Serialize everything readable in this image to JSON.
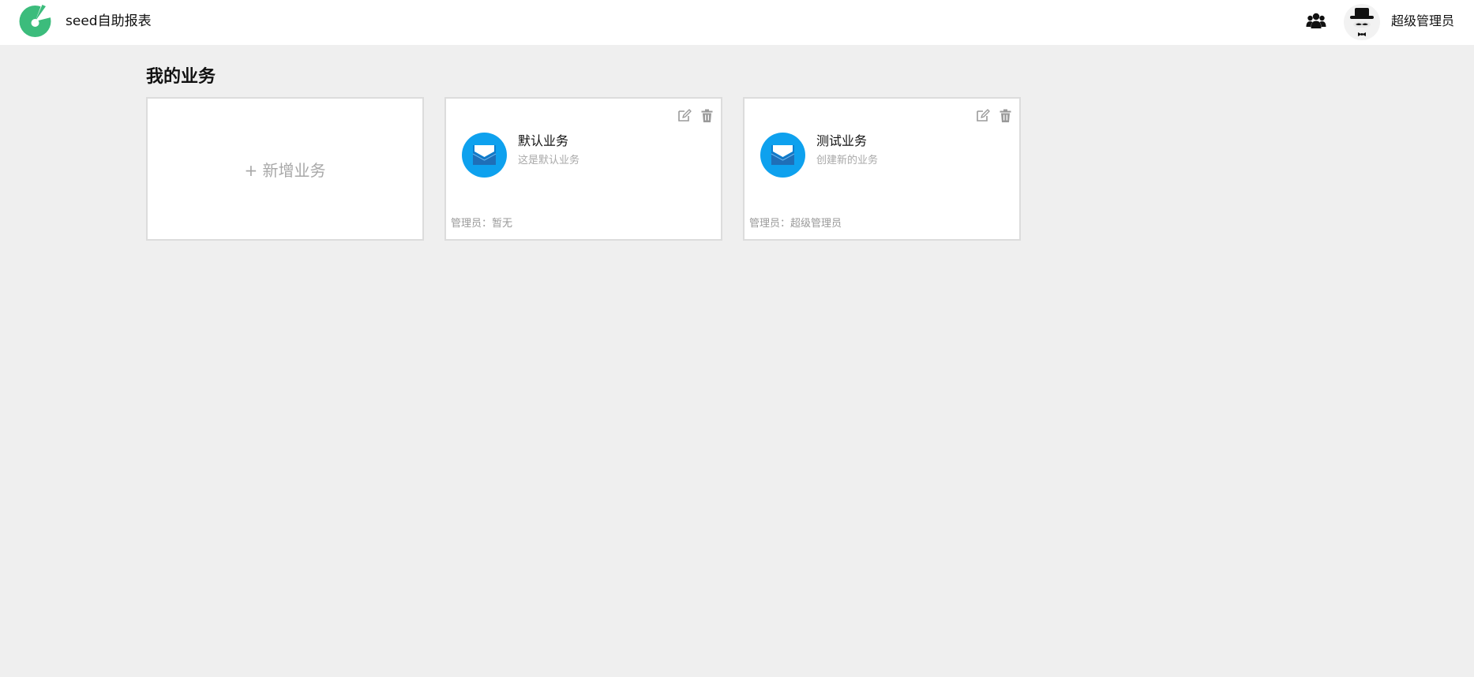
{
  "header": {
    "app_title": "seed自助报表",
    "logo_icon": "pie-chart-logo-icon",
    "team_icon": "team-users-icon",
    "avatar_icon": "top-hat-avatar-icon",
    "user_name": "超级管理员"
  },
  "main": {
    "section_title": "我的业务",
    "add_card_label": "+ 新增业务",
    "businesses": [
      {
        "name": "默认业务",
        "description": "这是默认业务",
        "admin": "管理员：暂无",
        "icon": "mail-icon"
      },
      {
        "name": "测试业务",
        "description": "创建新的业务",
        "admin": "管理员：超级管理员",
        "icon": "mail-icon"
      }
    ]
  },
  "colors": {
    "brand_green": "#3cbc7c",
    "biz_icon_blue": "#0ea1ee",
    "page_bg": "#efefef"
  }
}
